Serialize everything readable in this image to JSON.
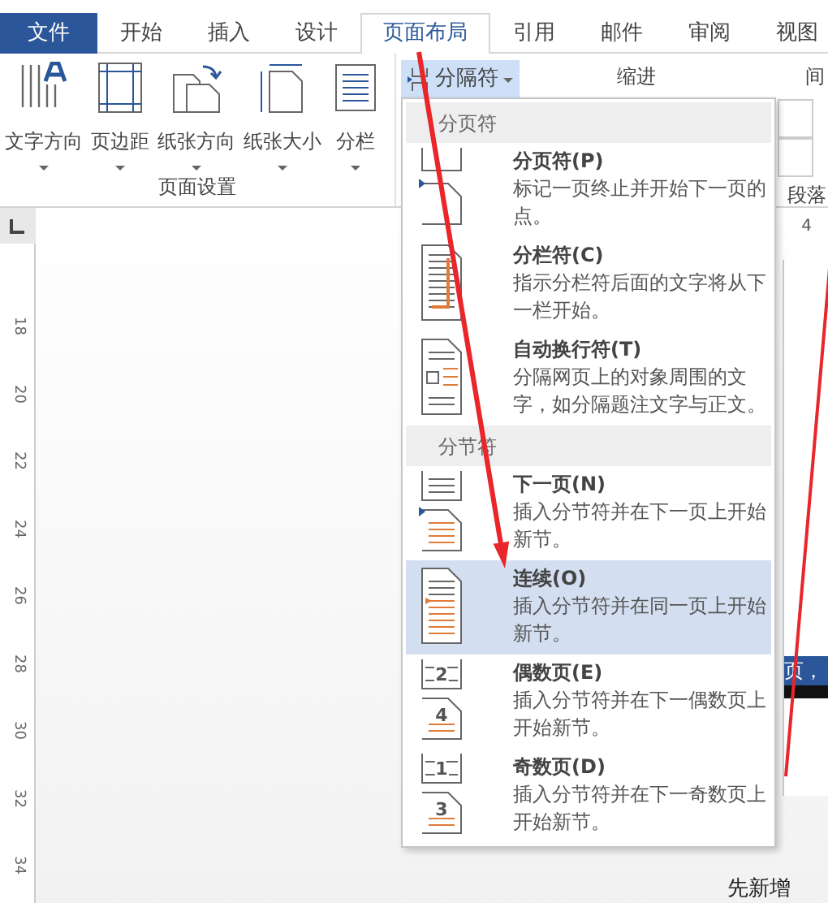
{
  "tabs": [
    {
      "label": "文件",
      "kind": "file",
      "selected": false
    },
    {
      "label": "开始",
      "kind": "tab",
      "selected": false
    },
    {
      "label": "插入",
      "kind": "tab",
      "selected": false
    },
    {
      "label": "设计",
      "kind": "tab",
      "selected": false
    },
    {
      "label": "页面布局",
      "kind": "tab",
      "selected": true
    },
    {
      "label": "引用",
      "kind": "tab",
      "selected": false
    },
    {
      "label": "邮件",
      "kind": "tab",
      "selected": false
    },
    {
      "label": "审阅",
      "kind": "tab",
      "selected": false
    },
    {
      "label": "视图",
      "kind": "tab",
      "selected": false
    }
  ],
  "ribbon": {
    "page_setup": {
      "buttons": [
        {
          "label": "文字方向",
          "kind": "text-direction"
        },
        {
          "label": "页边距",
          "kind": "margins"
        },
        {
          "label": "纸张方向",
          "kind": "orientation"
        },
        {
          "label": "纸张大小",
          "kind": "size"
        },
        {
          "label": "分栏",
          "kind": "columns"
        }
      ],
      "group_label": "页面设置"
    },
    "breaks_button": {
      "label": "分隔符",
      "expanded": true
    },
    "indent_label": "缩进",
    "spacing_label": "间",
    "paragraph_label": "段落"
  },
  "ruler": {
    "horizontal_number": "4",
    "vertical_numbers": [
      "18",
      "20",
      "22",
      "24",
      "26",
      "28",
      "30",
      "32",
      "34"
    ]
  },
  "document": {
    "selected_text": "页，",
    "bottom_text": "先新增"
  },
  "breaks_menu": [
    {
      "header": "分页符",
      "items": [
        {
          "kind": "page-break",
          "title": "分页符(P)",
          "description": "标记一页终止并开始下一页的点。",
          "selected": false
        },
        {
          "kind": "column-break",
          "title": "分栏符(C)",
          "description": "指示分栏符后面的文字将从下一栏开始。",
          "selected": false
        },
        {
          "kind": "text-wrap",
          "title": "自动换行符(T)",
          "description": "分隔网页上的对象周围的文字，如分隔题注文字与正文。",
          "selected": false
        }
      ]
    },
    {
      "header": "分节符",
      "items": [
        {
          "kind": "next-page",
          "title": "下一页(N)",
          "description": "插入分节符并在下一页上开始新节。",
          "selected": false
        },
        {
          "kind": "continuous",
          "title": "连续(O)",
          "description": "插入分节符并在同一页上开始新节。",
          "selected": true
        },
        {
          "kind": "numbered",
          "title": "偶数页(E)",
          "description": "插入分节符并在下一偶数页上开始新节。",
          "page_numbers": [
            "2",
            "4"
          ],
          "selected": false
        },
        {
          "kind": "numbered",
          "title": "奇数页(D)",
          "description": "插入分节符并在下一奇数页上开始新节。",
          "page_numbers": [
            "1",
            "3"
          ],
          "selected": false
        }
      ]
    }
  ]
}
